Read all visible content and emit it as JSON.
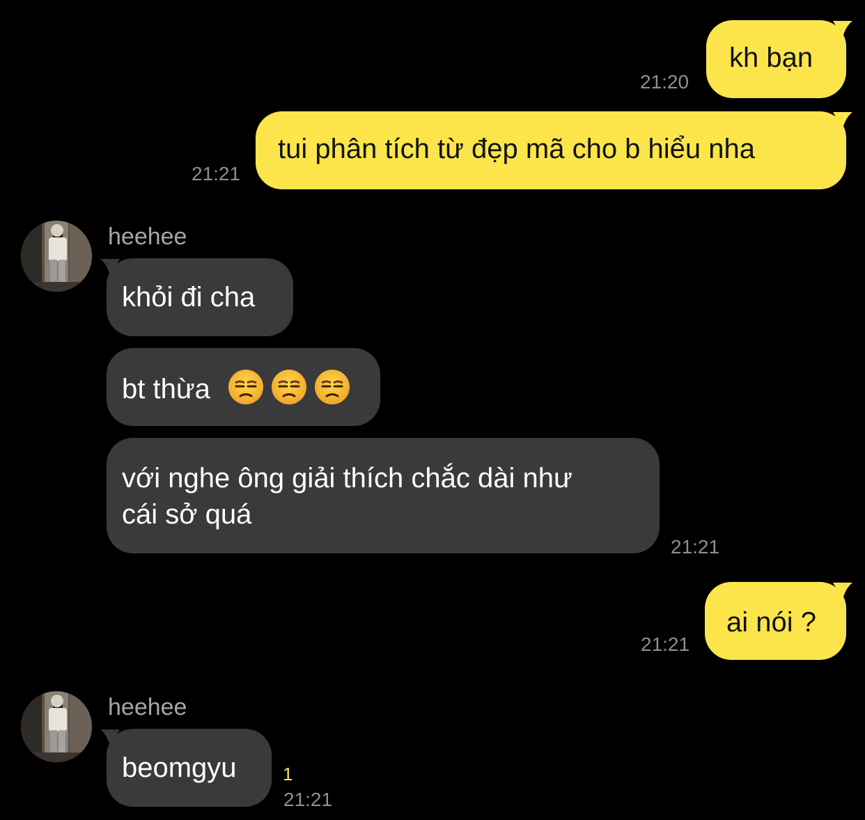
{
  "colors": {
    "background": "#000000",
    "outgoing_bubble": "#fbe54b",
    "incoming_bubble": "#3a3a3c",
    "timestamp": "#8e8e93",
    "unread_count": "#fbe54b"
  },
  "messages": {
    "m1": {
      "text": "kh bạn",
      "time": "21:20"
    },
    "m2": {
      "text": "tui phân tích từ đẹp mã cho b hiểu nha",
      "time": "21:21"
    },
    "group1": {
      "sender": "heehee",
      "m3": {
        "text": "khỏi đi cha"
      },
      "m4": {
        "text": "bt thừa",
        "emoji": [
          "unamused-face",
          "unamused-face",
          "unamused-face"
        ]
      },
      "m5": {
        "line1": "với nghe ông giải thích chắc dài như",
        "line2": "cái sở quá",
        "time": "21:21"
      }
    },
    "m6": {
      "text": "ai nói ?",
      "time": "21:21"
    },
    "group2": {
      "sender": "heehee",
      "m7": {
        "text": "beomgyu",
        "unread": "1",
        "time": "21:21"
      }
    }
  }
}
